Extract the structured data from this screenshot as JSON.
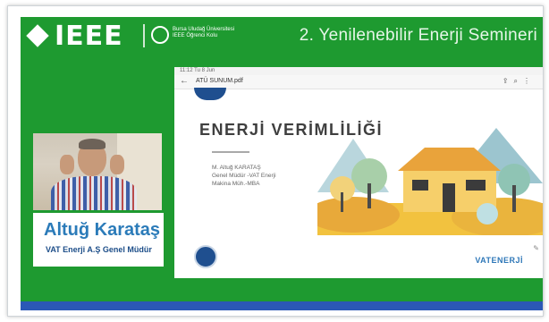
{
  "header": {
    "logo_text": "IEEE",
    "university_line1": "Bursa Uludağ Üniversitesi",
    "university_line2": "IEEE Öğrenci Kolu",
    "seminar_title": "2. Yenilenebilir Enerji Semineri"
  },
  "speaker": {
    "name": "Altuğ Karataş",
    "role": "VAT Enerji A.Ş Genel Müdür"
  },
  "shared_screen": {
    "status_time": "11:12 Tu 8 Jun",
    "file_name": "ATÜ SUNUM.pdf",
    "back_icon": "back-arrow-icon",
    "tool_icons": [
      "share-icon",
      "search-icon",
      "more-icon"
    ],
    "slide": {
      "title": "ENERJİ VERİMLİLİĞİ",
      "author_line1": "M. Altuğ KARATAŞ",
      "author_line2": "Genel Müdür -VAT Enerji",
      "author_line3": "Makina Müh.-MBA",
      "brand": "VATENERJİ"
    }
  },
  "colors": {
    "background_green": "#1e9a30",
    "speaker_blue": "#2b7bb9",
    "band_blue": "#2b58b6"
  }
}
